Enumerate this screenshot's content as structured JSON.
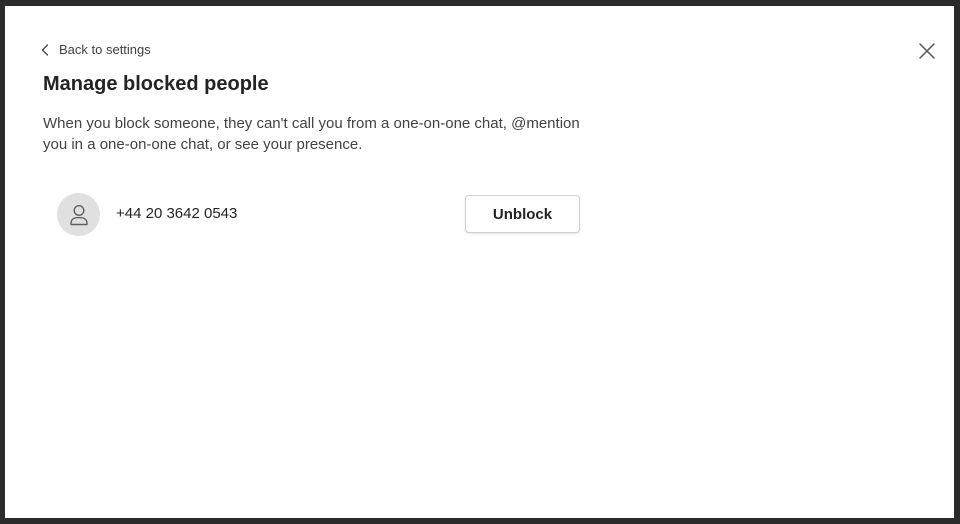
{
  "dialog": {
    "back_label": "Back to settings",
    "title": "Manage blocked people",
    "description": "When you block someone, they can't call you from a one-on-one chat, @mention you in a one-on-one chat, or see your presence.",
    "close_icon": "close-icon",
    "back_icon": "chevron-left-icon"
  },
  "blocked": [
    {
      "name": "+44 20 3642 0543",
      "avatar_icon": "person-icon",
      "action_label": "Unblock"
    }
  ],
  "colors": {
    "background_frame": "#2b2b2b",
    "dialog_bg": "#ffffff",
    "text_primary": "#242424",
    "text_secondary": "#424242",
    "avatar_bg": "#e0e0e0",
    "button_border": "#d1d1d1"
  }
}
